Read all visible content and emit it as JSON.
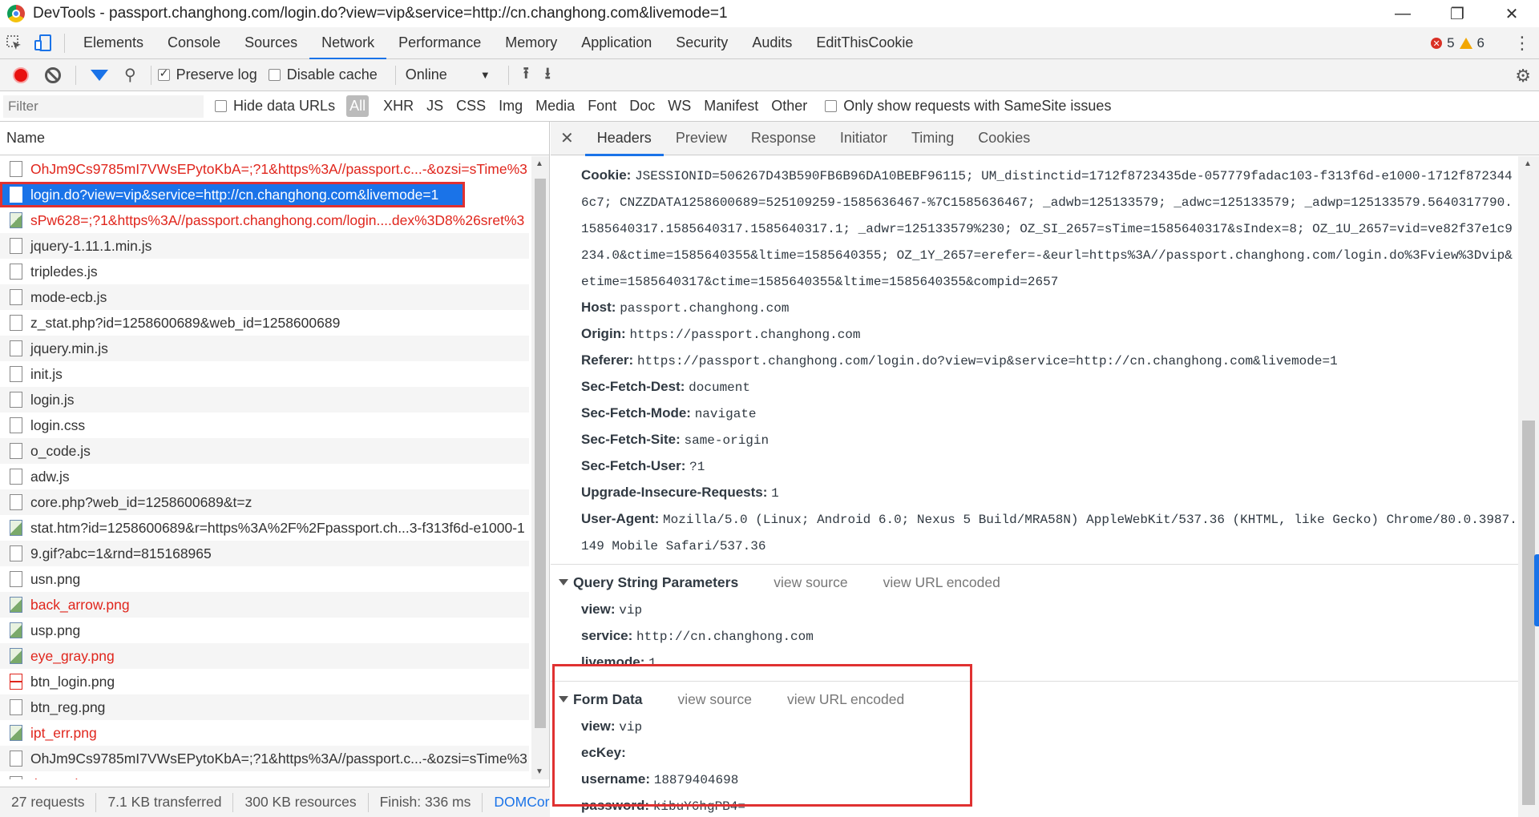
{
  "window": {
    "title": "DevTools - passport.changhong.com/login.do?view=vip&service=http://cn.changhong.com&livemode=1"
  },
  "tabs": [
    {
      "label": "Elements"
    },
    {
      "label": "Console"
    },
    {
      "label": "Sources"
    },
    {
      "label": "Network",
      "active": true
    },
    {
      "label": "Performance"
    },
    {
      "label": "Memory"
    },
    {
      "label": "Application"
    },
    {
      "label": "Security"
    },
    {
      "label": "Audits"
    },
    {
      "label": "EditThisCookie"
    }
  ],
  "counts": {
    "errors": "5",
    "warnings": "6"
  },
  "toolbar": {
    "preserve_log": "Preserve log",
    "disable_cache": "Disable cache",
    "throttle": "Online"
  },
  "filter": {
    "placeholder": "Filter",
    "hide_data_urls": "Hide data URLs",
    "types": [
      "All",
      "XHR",
      "JS",
      "CSS",
      "Img",
      "Media",
      "Font",
      "Doc",
      "WS",
      "Manifest",
      "Other"
    ],
    "samesite": "Only show requests with SameSite issues"
  },
  "list": {
    "header": "Name",
    "requests": [
      {
        "name": "OhJm9Cs9785mI7VWsEPytoKbA=;?1&https%3A//passport.c...-&ozsi=sTime%3",
        "status": "error",
        "icon": "file"
      },
      {
        "name": "login.do?view=vip&service=http://cn.changhong.com&livemode=1",
        "status": "selected",
        "icon": "file"
      },
      {
        "name": "sPw628=;?1&https%3A//passport.changhong.com/login....dex%3D8%26sret%3",
        "status": "error",
        "icon": "image"
      },
      {
        "name": "jquery-1.11.1.min.js",
        "status": "ok",
        "icon": "file"
      },
      {
        "name": "tripledes.js",
        "status": "ok",
        "icon": "file"
      },
      {
        "name": "mode-ecb.js",
        "status": "ok",
        "icon": "file"
      },
      {
        "name": "z_stat.php?id=1258600689&web_id=1258600689",
        "status": "ok",
        "icon": "file"
      },
      {
        "name": "jquery.min.js",
        "status": "ok",
        "icon": "file"
      },
      {
        "name": "init.js",
        "status": "ok",
        "icon": "file"
      },
      {
        "name": "login.js",
        "status": "ok",
        "icon": "file"
      },
      {
        "name": "login.css",
        "status": "ok",
        "icon": "file"
      },
      {
        "name": "o_code.js",
        "status": "ok",
        "icon": "file"
      },
      {
        "name": "adw.js",
        "status": "ok",
        "icon": "file"
      },
      {
        "name": "core.php?web_id=1258600689&t=z",
        "status": "ok",
        "icon": "file"
      },
      {
        "name": "stat.htm?id=1258600689&r=https%3A%2F%2Fpassport.ch...3-f313f6d-e1000-1",
        "status": "ok",
        "icon": "image"
      },
      {
        "name": "9.gif?abc=1&rnd=815168965",
        "status": "ok",
        "icon": "file"
      },
      {
        "name": "usn.png",
        "status": "ok",
        "icon": "file"
      },
      {
        "name": "back_arrow.png",
        "status": "error",
        "icon": "image"
      },
      {
        "name": "usp.png",
        "status": "ok",
        "icon": "image"
      },
      {
        "name": "eye_gray.png",
        "status": "error",
        "icon": "image"
      },
      {
        "name": "btn_login.png",
        "status": "ok",
        "icon": "red"
      },
      {
        "name": "btn_reg.png",
        "status": "ok",
        "icon": "file"
      },
      {
        "name": "ipt_err.png",
        "status": "error",
        "icon": "image"
      },
      {
        "name": "OhJm9Cs9785mI7VWsEPytoKbA=;?1&https%3A//passport.c...-&ozsi=sTime%3",
        "status": "ok",
        "icon": "file"
      },
      {
        "name": "three_dots.png",
        "status": "error",
        "icon": "file"
      }
    ]
  },
  "status": {
    "requests": "27 requests",
    "transferred": "7.1 KB transferred",
    "resources": "300 KB resources",
    "finish": "Finish: 336 ms",
    "domcontent": "DOMCor"
  },
  "detail_tabs": [
    "Headers",
    "Preview",
    "Response",
    "Initiator",
    "Timing",
    "Cookies"
  ],
  "headers": {
    "cookie_key": "Cookie:",
    "cookie_value": "JSESSIONID=506267D43B590FB6B96DA10BEBF96115; UM_distinctid=1712f8723435de-057779fadac103-f313f6d-e1000-1712f8723446c7; CNZZDATA1258600689=525109259-1585636467-%7C1585636467; _adwb=125133579; _adwc=125133579; _adwp=125133579.5640317790.1585640317.1585640317.1585640317.1; _adwr=125133579%230; OZ_SI_2657=sTime=1585640317&sIndex=8; OZ_1U_2657=vid=ve82f37e1c9234.0&ctime=1585640355&ltime=1585640355; OZ_1Y_2657=erefer=-&eurl=https%3A//passport.changhong.com/login.do%3Fview%3Dvip&etime=1585640317&ctime=1585640355&ltime=1585640355&compid=2657",
    "rows": [
      {
        "key": "Host:",
        "value": "passport.changhong.com"
      },
      {
        "key": "Origin:",
        "value": "https://passport.changhong.com"
      },
      {
        "key": "Referer:",
        "value": "https://passport.changhong.com/login.do?view=vip&service=http://cn.changhong.com&livemode=1"
      },
      {
        "key": "Sec-Fetch-Dest:",
        "value": "document"
      },
      {
        "key": "Sec-Fetch-Mode:",
        "value": "navigate"
      },
      {
        "key": "Sec-Fetch-Site:",
        "value": "same-origin"
      },
      {
        "key": "Sec-Fetch-User:",
        "value": "?1"
      },
      {
        "key": "Upgrade-Insecure-Requests:",
        "value": "1"
      },
      {
        "key": "User-Agent:",
        "value": "Mozilla/5.0 (Linux; Android 6.0; Nexus 5 Build/MRA58N) AppleWebKit/537.36 (KHTML, like Gecko) Chrome/80.0.3987.149 Mobile Safari/537.36"
      }
    ]
  },
  "query": {
    "title": "Query String Parameters",
    "view_source": "view source",
    "view_url_encoded": "view URL encoded",
    "rows": [
      {
        "key": "view:",
        "value": "vip"
      },
      {
        "key": "service:",
        "value": "http://cn.changhong.com"
      },
      {
        "key": "livemode:",
        "value": "1"
      }
    ]
  },
  "form": {
    "title": "Form Data",
    "view_source": "view source",
    "view_url_encoded": "view URL encoded",
    "rows": [
      {
        "key": "view:",
        "value": "vip"
      },
      {
        "key": "ecKey:",
        "value": ""
      },
      {
        "key": "username:",
        "value": "18879404698"
      },
      {
        "key": "password:",
        "value": "kibuY6hgPB4="
      }
    ]
  },
  "colors": {
    "accent": "#1a73e8",
    "error": "#e0251c",
    "highlight_box": "#e03131"
  }
}
